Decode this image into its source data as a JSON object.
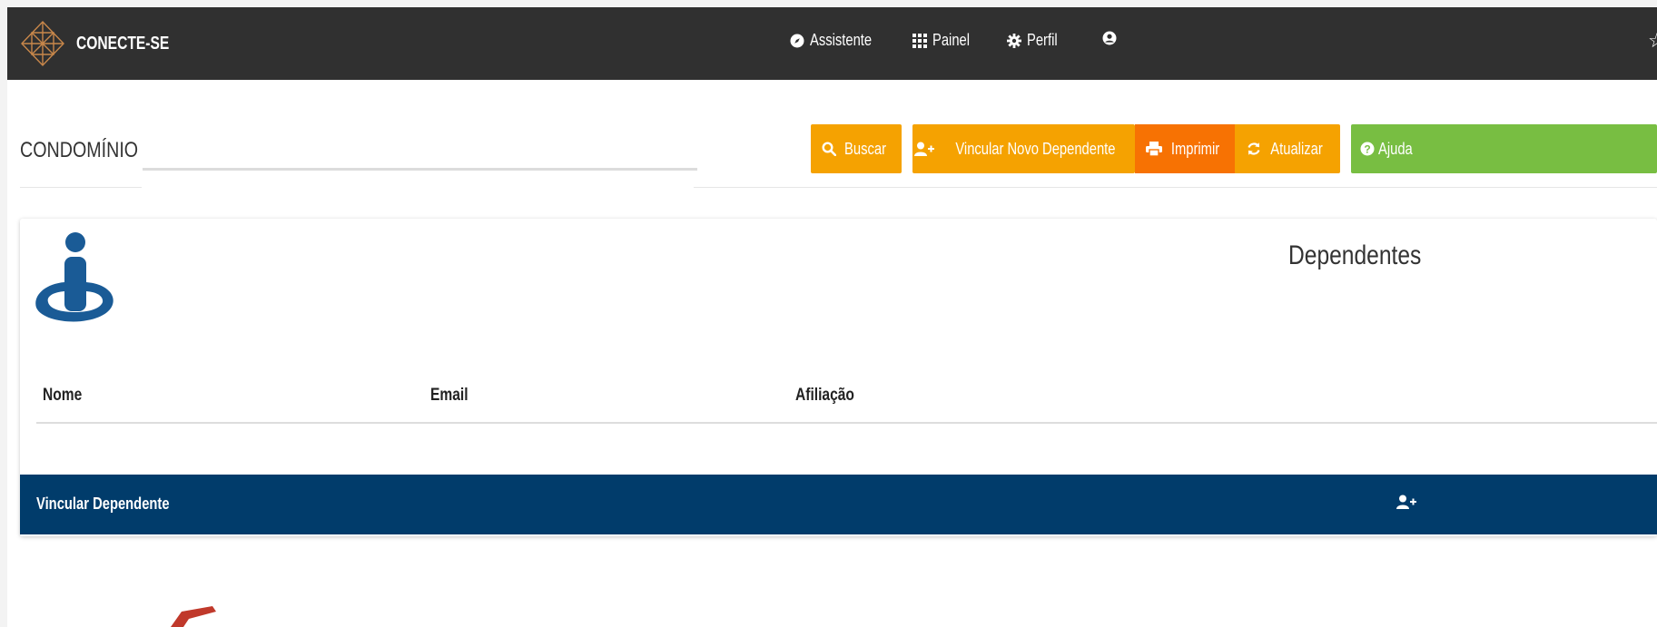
{
  "app": {
    "title": "CONECTE-SE"
  },
  "nav": {
    "assistente": "Assistente",
    "painel": "Painel",
    "perfil": "Perfil",
    "icons": [
      "compass-icon",
      "grid-icon",
      "gear-icon",
      "user-circle-icon",
      "star-icon"
    ]
  },
  "condominio": {
    "label": "CONDOMÍNIO",
    "value": ""
  },
  "toolbar": {
    "buscar": "Buscar",
    "vincular_novo": "Vincular Novo Dependente",
    "imprimir": "Imprimir",
    "atualizar": "Atualizar",
    "ajuda": "Ajuda"
  },
  "card": {
    "title": "Dependentes",
    "columns": [
      "Nome",
      "Email",
      "Afiliação"
    ],
    "rows": []
  },
  "footer": {
    "label": "Vincular Dependente"
  },
  "colors": {
    "topbar": "#303030",
    "orange": "#f5a201",
    "deep_orange": "#f77203",
    "green": "#78be42",
    "navy": "#013c6b",
    "icon_blue": "#1a5b96"
  }
}
